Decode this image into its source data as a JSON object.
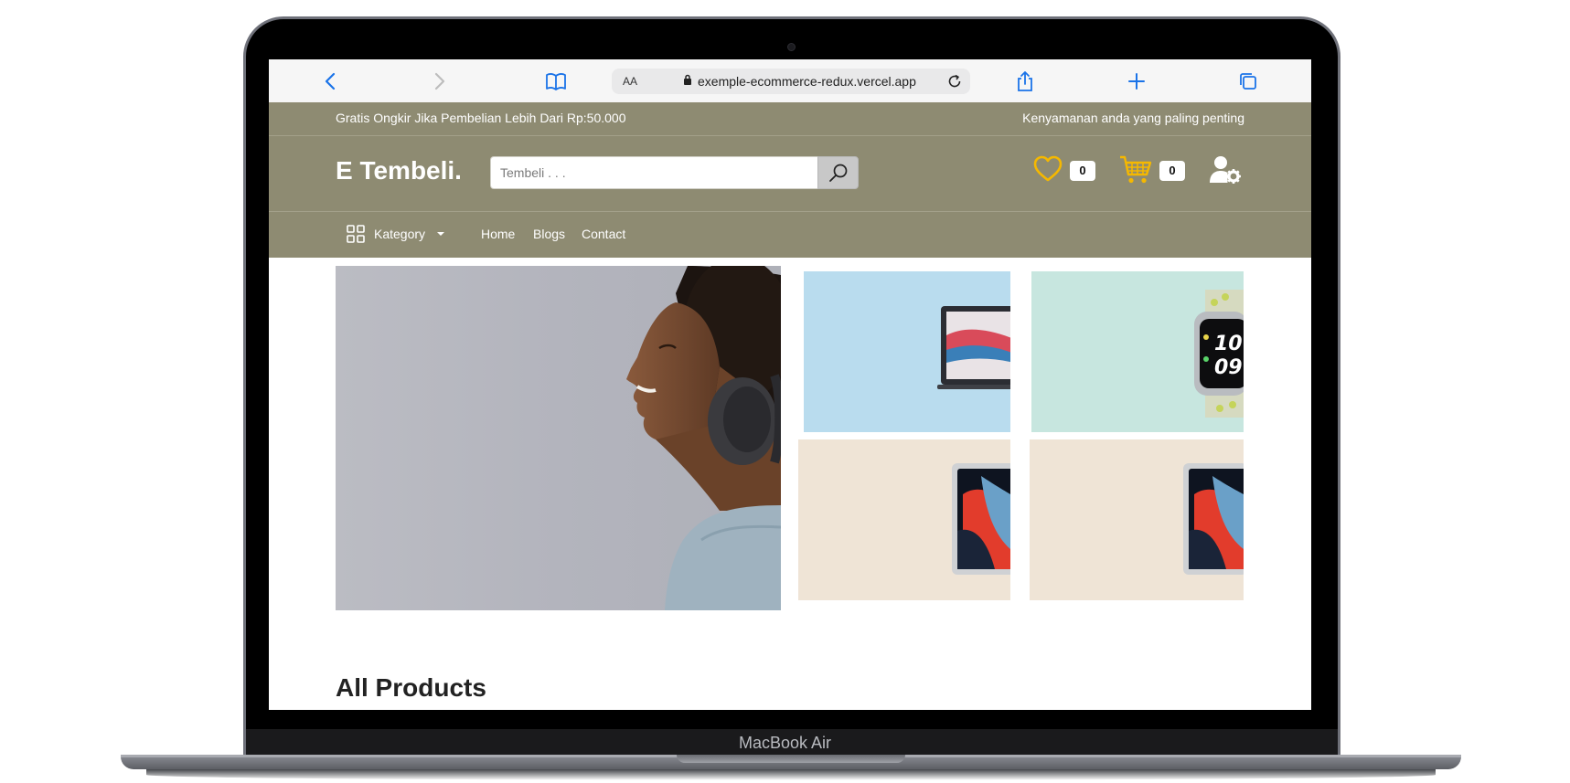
{
  "device": {
    "model": "MacBook Air"
  },
  "browser": {
    "url": "exemple-ecommerce-redux.vercel.app",
    "text_size_label": "AA",
    "icons": [
      "back-icon",
      "forward-icon",
      "bookmarks-icon",
      "lock-icon",
      "reload-icon",
      "share-icon",
      "new-tab-icon",
      "tabs-icon"
    ]
  },
  "topstrip": {
    "left_text": "Gratis Ongkir Jika Pembelian Lebih Dari Rp:50.000",
    "right_text": "Kenyamanan anda yang paling penting"
  },
  "header": {
    "logo": "E Tembeli.",
    "search_placeholder": "Tembeli . . .",
    "wishlist_count": "0",
    "cart_count": "0",
    "icon_color": "#f5b800"
  },
  "nav": {
    "category_label": "Kategory",
    "links": [
      "Home",
      "Blogs",
      "Contact"
    ]
  },
  "theme": {
    "header_bg": "#8e8b72"
  },
  "banners": [
    "headphones-woman",
    "laptop",
    "smartwatch",
    "tablet",
    "tablet"
  ],
  "section": {
    "title": "All Products"
  }
}
